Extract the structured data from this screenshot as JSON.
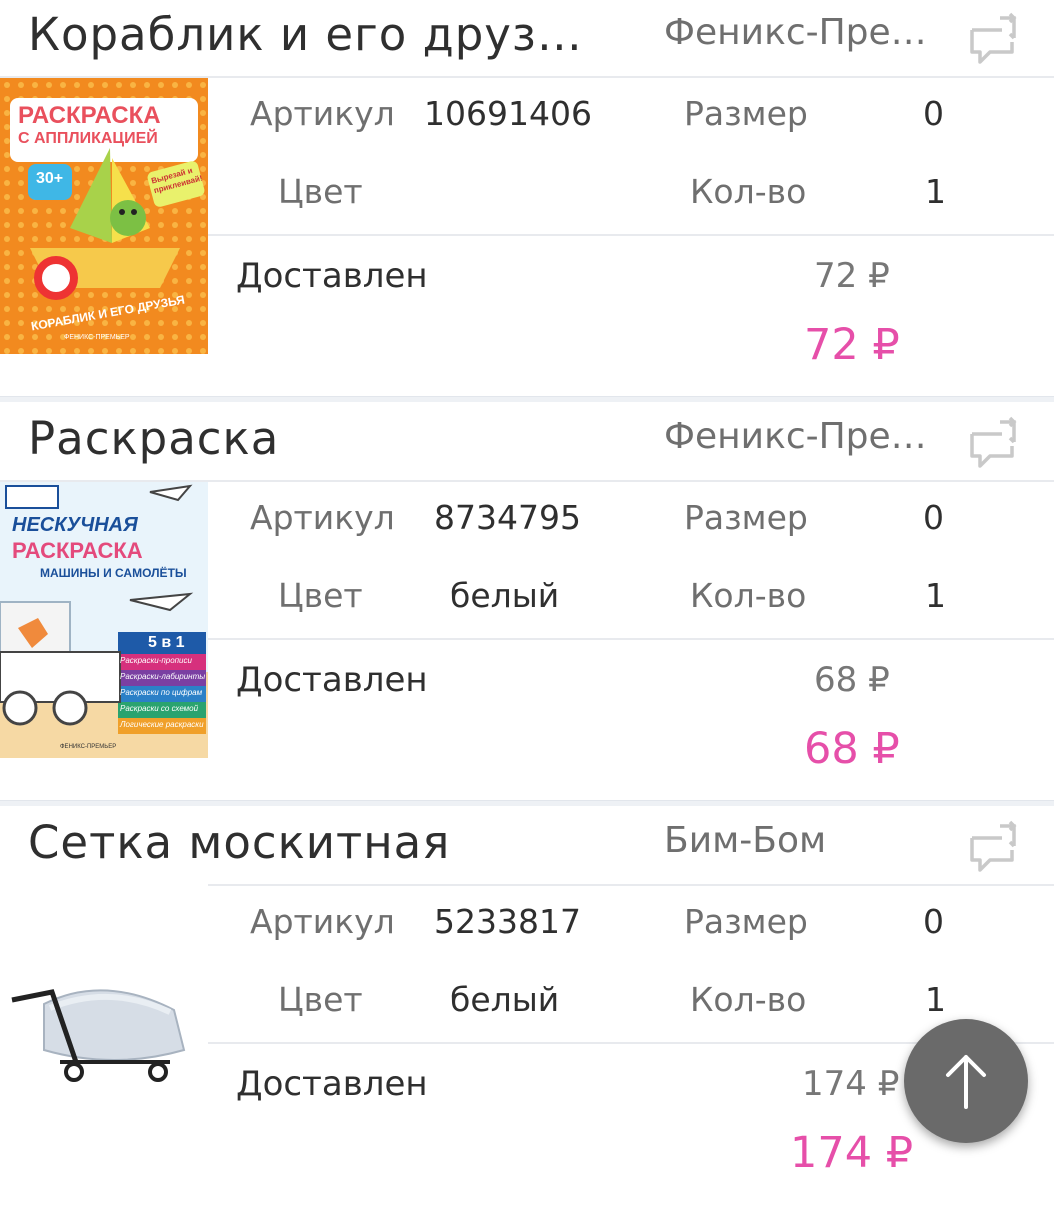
{
  "orders": [
    {
      "title": "Кораблик и его друз…",
      "seller": "Феникс-Пре…",
      "article_label": "Артикул",
      "article_value": "10691406",
      "size_label": "Размер",
      "size_value": "0",
      "color_label": "Цвет",
      "color_value": "",
      "qty_label": "Кол-во",
      "qty_value": "1",
      "status": "Доставлен",
      "price_old": "72 ₽",
      "price_new": "72 ₽",
      "thumb": {
        "heading1": "РАСКРАСКА",
        "heading2": "С АППЛИКАЦИЕЙ",
        "badge": "30+",
        "sticker": "Вырезай и приклеивай!",
        "bottom": "КОРАБЛИК И ЕГО ДРУЗЬЯ",
        "publisher": "ФЕНИКС-ПРЕМЬЕР"
      }
    },
    {
      "title": "Раскраска",
      "seller": "Феникс-Пре…",
      "article_label": "Артикул",
      "article_value": "8734795",
      "size_label": "Размер",
      "size_value": "0",
      "color_label": "Цвет",
      "color_value": "белый",
      "qty_label": "Кол-во",
      "qty_value": "1",
      "status": "Доставлен",
      "price_old": "68 ₽",
      "price_new": "68 ₽",
      "thumb": {
        "heading1": "НЕСКУЧНАЯ",
        "heading2": "РАСКРАСКА",
        "subtitle": "МАШИНЫ И САМОЛЁТЫ",
        "badge": "5 в 1",
        "stripes": [
          "Раскраски-прописи",
          "Раскраски-лабиринты",
          "Раскраски по цифрам",
          "Раскраски со схемой",
          "Логические раскраски"
        ],
        "publisher": "ФЕНИКС-ПРЕМЬЕР"
      }
    },
    {
      "title": "Сетка москитная",
      "seller": "Бим-Бом",
      "article_label": "Артикул",
      "article_value": "5233817",
      "size_label": "Размер",
      "size_value": "0",
      "color_label": "Цвет",
      "color_value": "белый",
      "qty_label": "Кол-во",
      "qty_value": "1",
      "status": "Доставлен",
      "price_old": "174 ₽",
      "price_new": "174 ₽"
    }
  ],
  "icons": {
    "chat": "chat-swap-icon",
    "scroll_top": "arrow-up-icon"
  },
  "colors": {
    "price_accent": "#e64fa9",
    "fab": "#6a6a6a",
    "separator": "#eef1f5"
  }
}
